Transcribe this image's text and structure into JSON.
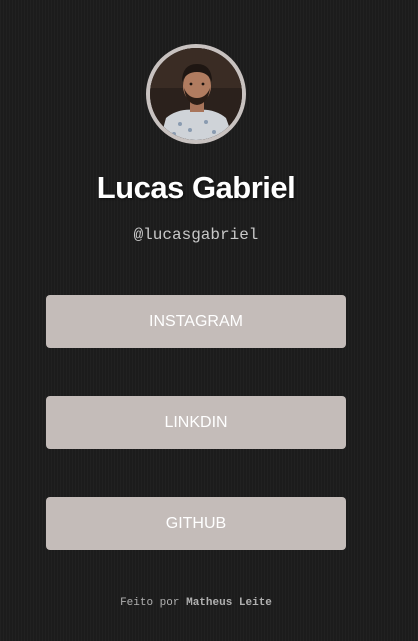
{
  "profile": {
    "name": "Lucas Gabriel",
    "handle": "@lucasgabriel"
  },
  "links": [
    {
      "label": "INSTAGRAM"
    },
    {
      "label": "LINKDIN"
    },
    {
      "label": "GITHUB"
    }
  ],
  "footer": {
    "prefix": "Feito por ",
    "author": "Matheus Leite"
  },
  "colors": {
    "background": "#1c1c1c",
    "button": "#c4bcb9",
    "avatar_border": "#c8c2c0"
  }
}
